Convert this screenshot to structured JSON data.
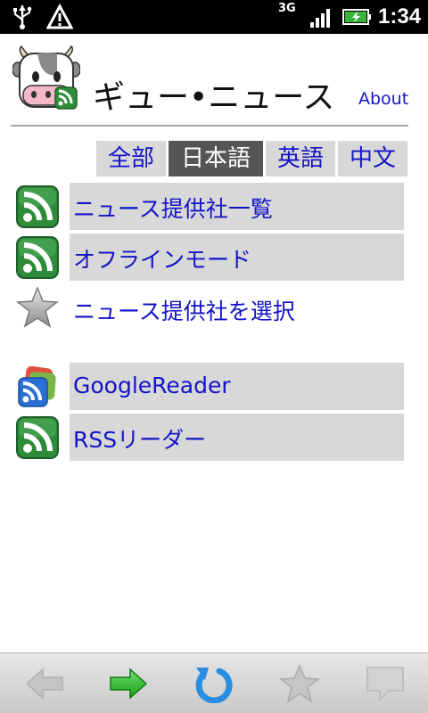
{
  "status_bar": {
    "network": "3G",
    "time": "1:34",
    "icons": [
      "usb-icon",
      "warning-icon",
      "signal-icon",
      "battery-charging-icon"
    ]
  },
  "header": {
    "app_title": "ギュー•ニュース",
    "about_label": "About",
    "logo_icon": "cow-rss-logo-icon"
  },
  "language_tabs": [
    {
      "label": "全部",
      "active": false
    },
    {
      "label": "日本語",
      "active": true
    },
    {
      "label": "英語",
      "active": false
    },
    {
      "label": "中文",
      "active": false
    }
  ],
  "menu": {
    "items": [
      {
        "label": "ニュース提供社一覧",
        "icon": "rss-icon",
        "highlighted": true
      },
      {
        "label": "オフラインモード",
        "icon": "rss-icon",
        "highlighted": true
      },
      {
        "label": "ニュース提供社を選択",
        "icon": "star-icon",
        "highlighted": false
      }
    ],
    "readers": [
      {
        "label": "GoogleReader",
        "icon": "google-reader-icon",
        "highlighted": true
      },
      {
        "label": "RSSリーダー",
        "icon": "rss-icon",
        "highlighted": true
      }
    ]
  },
  "toolbar": {
    "buttons": [
      "back-arrow-icon",
      "forward-arrow-icon",
      "refresh-icon",
      "favorite-star-icon",
      "comment-icon"
    ]
  },
  "colors": {
    "link": "#1414c8",
    "tab_active_bg": "#555555",
    "row_bg": "#d8d8d8",
    "rss_green": "#2e8b3a",
    "forward_green": "#22b022",
    "refresh_blue": "#2a8ee0"
  }
}
